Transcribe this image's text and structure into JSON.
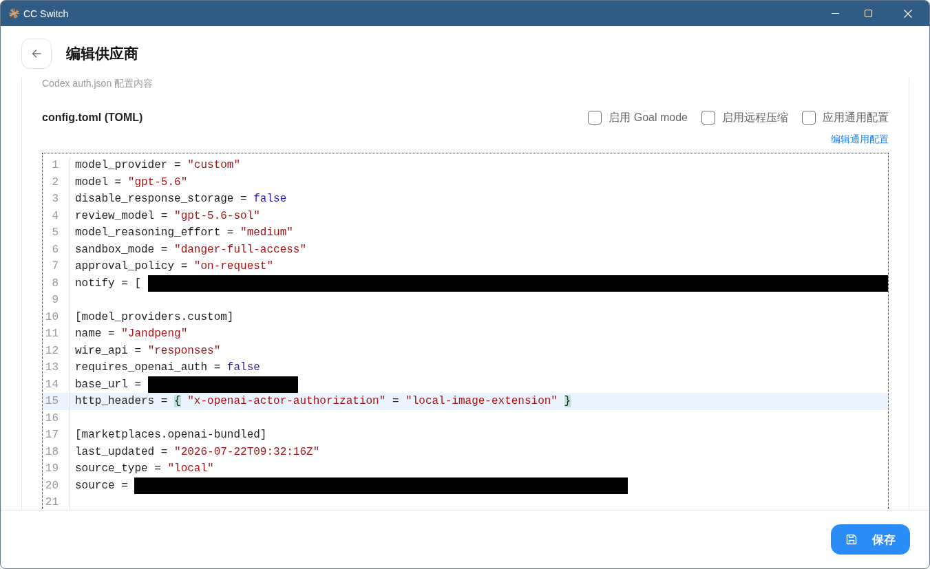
{
  "window": {
    "title": "CC Switch"
  },
  "header": {
    "title": "编辑供应商"
  },
  "section_label": "Codex auth.json 配置内容",
  "config": {
    "title": "config.toml (TOML)",
    "options": [
      {
        "label": "启用 Goal mode",
        "checked": false
      },
      {
        "label": "启用远程压缩",
        "checked": false
      },
      {
        "label": "应用通用配置",
        "checked": false
      }
    ],
    "link": "编辑通用配置"
  },
  "editor": {
    "lines": [
      {
        "number": "1",
        "selected": false,
        "tokens": [
          {
            "kind": "plain",
            "text": "model_provider = "
          },
          {
            "kind": "string",
            "text": "\"custom\""
          }
        ]
      },
      {
        "number": "2",
        "selected": false,
        "tokens": [
          {
            "kind": "plain",
            "text": "model = "
          },
          {
            "kind": "string",
            "text": "\"gpt-5.6\""
          }
        ]
      },
      {
        "number": "3",
        "selected": false,
        "tokens": [
          {
            "kind": "plain",
            "text": "disable_response_storage = "
          },
          {
            "kind": "keyword",
            "text": "false"
          }
        ]
      },
      {
        "number": "4",
        "selected": false,
        "tokens": [
          {
            "kind": "plain",
            "text": "review_model = "
          },
          {
            "kind": "string",
            "text": "\"gpt-5.6-sol\""
          }
        ]
      },
      {
        "number": "5",
        "selected": false,
        "tokens": [
          {
            "kind": "plain",
            "text": "model_reasoning_effort = "
          },
          {
            "kind": "string",
            "text": "\"medium\""
          }
        ]
      },
      {
        "number": "6",
        "selected": false,
        "tokens": [
          {
            "kind": "plain",
            "text": "sandbox_mode = "
          },
          {
            "kind": "string",
            "text": "\"danger-full-access\""
          }
        ]
      },
      {
        "number": "7",
        "selected": false,
        "tokens": [
          {
            "kind": "plain",
            "text": "approval_policy = "
          },
          {
            "kind": "string",
            "text": "\"on-request\""
          }
        ]
      },
      {
        "number": "8",
        "selected": false,
        "tokens": [
          {
            "kind": "plain",
            "text": "notify = [ "
          },
          {
            "kind": "redacted"
          }
        ]
      },
      {
        "number": "9",
        "selected": false
      },
      {
        "number": "10",
        "selected": false,
        "tokens": [
          {
            "kind": "plain",
            "text": "[model_providers.custom]"
          }
        ]
      },
      {
        "number": "11",
        "selected": false,
        "tokens": [
          {
            "kind": "plain",
            "text": "name = "
          },
          {
            "kind": "string",
            "text": "\"Jandpeng\""
          }
        ]
      },
      {
        "number": "12",
        "selected": false,
        "tokens": [
          {
            "kind": "plain",
            "text": "wire_api = "
          },
          {
            "kind": "string",
            "text": "\"responses\""
          }
        ]
      },
      {
        "number": "13",
        "selected": false,
        "tokens": [
          {
            "kind": "plain",
            "text": "requires_openai_auth = "
          },
          {
            "kind": "keyword",
            "text": "false"
          }
        ]
      },
      {
        "number": "14",
        "selected": false,
        "tokens": [
          {
            "kind": "plain",
            "text": "base_url = "
          },
          {
            "kind": "redacted"
          }
        ]
      },
      {
        "number": "15",
        "selected": true,
        "tokens": [
          {
            "kind": "plain",
            "text": "http_headers = "
          },
          {
            "kind": "bracket",
            "text": "{"
          },
          {
            "kind": "string",
            "text": " \"x-openai-actor-authorization\""
          },
          {
            "kind": "plain",
            "text": " = "
          },
          {
            "kind": "string",
            "text": "\"local-image-extension\" "
          },
          {
            "kind": "bracket",
            "text": "}"
          }
        ]
      },
      {
        "number": "16",
        "selected": false
      },
      {
        "number": "17",
        "selected": false,
        "tokens": [
          {
            "kind": "plain",
            "text": "[marketplaces.openai-bundled]"
          }
        ]
      },
      {
        "number": "18",
        "selected": false,
        "tokens": [
          {
            "kind": "plain",
            "text": "last_updated = "
          },
          {
            "kind": "string",
            "text": "\"2026-07-22T09:32:16Z\""
          }
        ]
      },
      {
        "number": "19",
        "selected": false,
        "tokens": [
          {
            "kind": "plain",
            "text": "source_type = "
          },
          {
            "kind": "string",
            "text": "\"local\""
          }
        ]
      },
      {
        "number": "20",
        "selected": false,
        "tokens": [
          {
            "kind": "plain",
            "text": "source = "
          },
          {
            "kind": "redacted"
          }
        ]
      },
      {
        "number": "21",
        "selected": false
      }
    ]
  },
  "footer": {
    "save_button": "保存"
  }
}
